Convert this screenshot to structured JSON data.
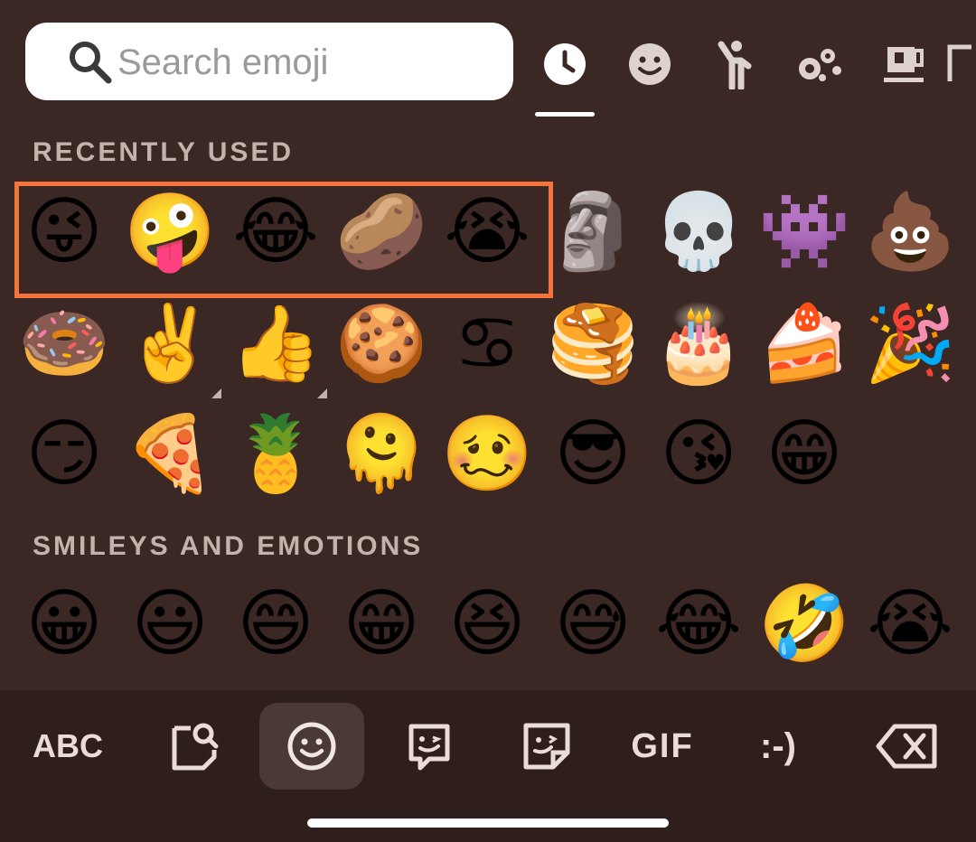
{
  "search": {
    "placeholder": "Search emoji"
  },
  "category_tabs": [
    {
      "name": "recent-tab",
      "icon": "clock-icon",
      "selected": true
    },
    {
      "name": "smileys-tab",
      "icon": "smiley-icon",
      "selected": false
    },
    {
      "name": "people-tab",
      "icon": "person-icon",
      "selected": false
    },
    {
      "name": "nature-tab",
      "icon": "flower-icon",
      "selected": false
    },
    {
      "name": "food-tab",
      "icon": "cup-icon",
      "selected": false
    },
    {
      "name": "more-tab",
      "icon": "partial-icon",
      "selected": false
    }
  ],
  "sections": {
    "recent": {
      "title": "RECENTLY USED",
      "emojis": [
        "😜",
        "🤪",
        "😂",
        "🥔",
        "😭",
        "🗿",
        "💀",
        "👾",
        "💩",
        "🍩",
        "✌️",
        "👍",
        "🍪",
        "♋",
        "🥞",
        "🎂",
        "🍰",
        "🎉",
        "😏",
        "🍕",
        "🍍",
        "🫠",
        "🥴",
        "😎",
        "😘",
        "😁"
      ],
      "highlighted": [
        "😜",
        "🤪",
        "😂",
        "🥔",
        "😭"
      ]
    },
    "smileys": {
      "title": "SMILEYS AND EMOTIONS",
      "emojis": [
        "😀",
        "😃",
        "😄",
        "😁",
        "😆",
        "😅",
        "😂",
        "🤣",
        "😭"
      ]
    }
  },
  "variant_marks": [
    "✌️",
    "👍"
  ],
  "bottom_bar": {
    "abc_label": "ABC",
    "gif_label": "GIF",
    "emoticon_label": ":-)",
    "keys": [
      {
        "name": "abc-key",
        "icon": null
      },
      {
        "name": "sticker-search-key",
        "icon": "sticker-search-icon"
      },
      {
        "name": "emoji-key",
        "icon": "smiley-icon",
        "active": true
      },
      {
        "name": "bitmoji-key",
        "icon": "wink-bubble-icon"
      },
      {
        "name": "sticker-key",
        "icon": "sticker-icon"
      },
      {
        "name": "gif-key",
        "icon": null
      },
      {
        "name": "emoticon-key",
        "icon": null
      },
      {
        "name": "backspace-key",
        "icon": "backspace-icon"
      }
    ]
  },
  "colors": {
    "background": "#3b2724",
    "bar": "#2e1f1c",
    "highlight": "#f4743b",
    "section_title": "#c4b3ad"
  }
}
